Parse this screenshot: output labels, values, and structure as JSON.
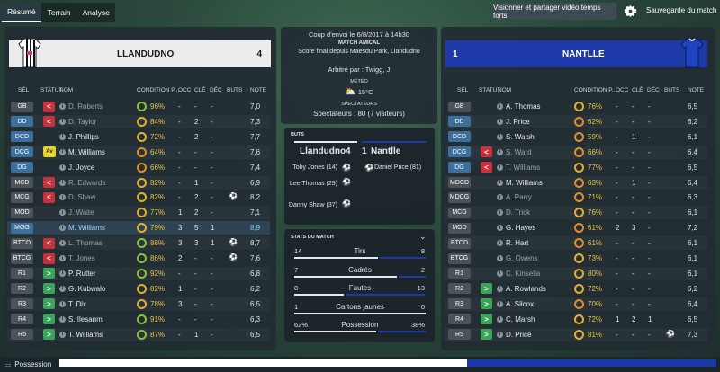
{
  "nav": {
    "tabs": [
      "Résumé",
      "Terrain",
      "Analyse"
    ],
    "active": 0
  },
  "toolbar": {
    "video_label": "Visionner et partager vidéo temps forts",
    "save_label": "Sauvegarde du match"
  },
  "info": {
    "kickoff": "Coup d'envoi le 6/8/2017 à 14h30",
    "competition": "MATCH AMICAL",
    "venue": "Score final depuis Maesdu Park, Llandudno",
    "referee": "Arbitré par : Twigg, J",
    "weather_label": "MÉTÉO",
    "weather_value": "15°C",
    "spectators_label": "SPECTATEURS",
    "spectators_value": "Spectateurs : 80 (7 visiteurs)"
  },
  "home": {
    "name": "LLANDUDNO",
    "score": "4",
    "color": "#eeeeee",
    "text_color": "#1a1a1a"
  },
  "away": {
    "name": "NANTLLE",
    "score": "1",
    "color": "#1e3aa8",
    "text_color": "#ffffff"
  },
  "headers": {
    "sel": "SÉL",
    "statut": "STATUT",
    "nom": "NOM",
    "cond": "CONDITION P...",
    "occ": "OCC",
    "cle": "CLÉ",
    "dec": "DÉC",
    "buts": "BUTS",
    "note": "NOTE"
  },
  "home_players": [
    {
      "pos": "GB",
      "posc": "#4a5358",
      "stat": "sub",
      "name": "D. Roberts",
      "cond": "96%",
      "ring": "g",
      "occ": "-",
      "cle": "-",
      "dec": "-",
      "goal": "",
      "note": "7,0",
      "dim": true
    },
    {
      "pos": "DD",
      "posc": "#3b6f9c",
      "stat": "sub",
      "name": "D. Taylor",
      "cond": "84%",
      "ring": "y",
      "occ": "-",
      "cle": "2",
      "dec": "-",
      "goal": "",
      "note": "7,3",
      "dim": true
    },
    {
      "pos": "DCD",
      "posc": "#3b6f9c",
      "stat": "",
      "name": "J. Phillips",
      "cond": "72%",
      "ring": "y",
      "occ": "-",
      "cle": "2",
      "dec": "-",
      "goal": "",
      "note": "7,7",
      "dim": false
    },
    {
      "pos": "DCG",
      "posc": "#3b6f9c",
      "stat": "Av",
      "name": "M. Williams",
      "cond": "64%",
      "ring": "o",
      "occ": "-",
      "cle": "-",
      "dec": "-",
      "goal": "",
      "note": "7,6",
      "dim": false
    },
    {
      "pos": "DG",
      "posc": "#3b6f9c",
      "stat": "",
      "name": "J. Joyce",
      "cond": "66%",
      "ring": "o",
      "occ": "-",
      "cle": "-",
      "dec": "-",
      "goal": "",
      "note": "7,4",
      "dim": false
    },
    {
      "pos": "MCD",
      "posc": "#4a5358",
      "stat": "sub",
      "name": "R. Edwards",
      "cond": "82%",
      "ring": "y",
      "occ": "-",
      "cle": "1",
      "dec": "-",
      "goal": "",
      "note": "6,9",
      "dim": true
    },
    {
      "pos": "MCG",
      "posc": "#4a5358",
      "stat": "sub",
      "name": "D. Shaw",
      "cond": "82%",
      "ring": "y",
      "occ": "-",
      "cle": "2",
      "dec": "-",
      "goal": "⚽",
      "note": "8,2",
      "dim": true
    },
    {
      "pos": "MOD",
      "posc": "#4a5358",
      "stat": "",
      "name": "J. Waite",
      "cond": "77%",
      "ring": "y",
      "occ": "1",
      "cle": "2",
      "dec": "-",
      "goal": "",
      "note": "7,1",
      "dim": true
    },
    {
      "pos": "MOG",
      "posc": "#3b6f9c",
      "stat": "",
      "name": "M. Williams",
      "cond": "79%",
      "ring": "y",
      "occ": "3",
      "cle": "5",
      "dec": "1",
      "goal": "",
      "note": "8,9",
      "dim": false,
      "hl": true
    },
    {
      "pos": "BTCD",
      "posc": "#4a5358",
      "stat": "sub",
      "name": "L. Thomas",
      "cond": "88%",
      "ring": "g",
      "occ": "3",
      "cle": "3",
      "dec": "1",
      "goal": "⚽",
      "note": "8,7",
      "dim": true
    },
    {
      "pos": "BTCG",
      "posc": "#4a5358",
      "stat": "sub",
      "name": "T. Jones",
      "cond": "86%",
      "ring": "g",
      "occ": "2",
      "cle": "-",
      "dec": "-",
      "goal": "⚽",
      "note": "7,6",
      "dim": true
    },
    {
      "pos": "R1",
      "posc": "#4a5358",
      "stat": "in",
      "name": "P. Rutter",
      "cond": "92%",
      "ring": "g",
      "occ": "-",
      "cle": "-",
      "dec": "-",
      "goal": "",
      "note": "6,8",
      "dim": false
    },
    {
      "pos": "R2",
      "posc": "#4a5358",
      "stat": "in",
      "name": "G. Kubwalo",
      "cond": "82%",
      "ring": "y",
      "occ": "1",
      "cle": "-",
      "dec": "-",
      "goal": "",
      "note": "6,2",
      "dim": false
    },
    {
      "pos": "R3",
      "posc": "#4a5358",
      "stat": "in",
      "name": "T. Dix",
      "cond": "78%",
      "ring": "y",
      "occ": "3",
      "cle": "-",
      "dec": "-",
      "goal": "",
      "note": "6,5",
      "dim": false
    },
    {
      "pos": "R4",
      "posc": "#4a5358",
      "stat": "in",
      "name": "S. Ilesanmi",
      "cond": "91%",
      "ring": "g",
      "occ": "-",
      "cle": "-",
      "dec": "-",
      "goal": "",
      "note": "6,3",
      "dim": false
    },
    {
      "pos": "R5",
      "posc": "#4a5358",
      "stat": "in",
      "name": "T. Williams",
      "cond": "87%",
      "ring": "g",
      "occ": "-",
      "cle": "1",
      "dec": "-",
      "goal": "",
      "note": "6,5",
      "dim": false
    }
  ],
  "away_players": [
    {
      "pos": "GB",
      "posc": "#4a5358",
      "stat": "",
      "name": "A. Thomas",
      "cond": "76%",
      "ring": "y",
      "occ": "-",
      "cle": "-",
      "dec": "-",
      "goal": "",
      "note": "6,5",
      "dim": false
    },
    {
      "pos": "DD",
      "posc": "#3b6f9c",
      "stat": "",
      "name": "J. Price",
      "cond": "62%",
      "ring": "o",
      "occ": "-",
      "cle": "-",
      "dec": "-",
      "goal": "",
      "note": "6,2",
      "dim": false
    },
    {
      "pos": "DCD",
      "posc": "#3b6f9c",
      "stat": "",
      "name": "S. Walsh",
      "cond": "59%",
      "ring": "o",
      "occ": "-",
      "cle": "1",
      "dec": "-",
      "goal": "",
      "note": "6,1",
      "dim": false
    },
    {
      "pos": "DCG",
      "posc": "#3b6f9c",
      "stat": "sub",
      "name": "S. Ward",
      "cond": "66%",
      "ring": "o",
      "occ": "-",
      "cle": "-",
      "dec": "-",
      "goal": "",
      "note": "6,4",
      "dim": true
    },
    {
      "pos": "DG",
      "posc": "#3b6f9c",
      "stat": "sub",
      "name": "T. Williams",
      "cond": "77%",
      "ring": "y",
      "occ": "-",
      "cle": "-",
      "dec": "-",
      "goal": "",
      "note": "6,5",
      "dim": true
    },
    {
      "pos": "MDCD",
      "posc": "#4a5358",
      "stat": "",
      "name": "M. Williams",
      "cond": "63%",
      "ring": "o",
      "occ": "-",
      "cle": "1",
      "dec": "-",
      "goal": "",
      "note": "6,4",
      "dim": false
    },
    {
      "pos": "MDCG",
      "posc": "#4a5358",
      "stat": "",
      "name": "A. Parry",
      "cond": "71%",
      "ring": "o",
      "occ": "-",
      "cle": "-",
      "dec": "-",
      "goal": "",
      "note": "6,3",
      "dim": true
    },
    {
      "pos": "MCG",
      "posc": "#4a5358",
      "stat": "",
      "name": "D. Trick",
      "cond": "76%",
      "ring": "y",
      "occ": "-",
      "cle": "-",
      "dec": "-",
      "goal": "",
      "note": "6,1",
      "dim": true
    },
    {
      "pos": "MOD",
      "posc": "#4a5358",
      "stat": "",
      "name": "G. Hayes",
      "cond": "61%",
      "ring": "o",
      "occ": "2",
      "cle": "3",
      "dec": "-",
      "goal": "",
      "note": "7,2",
      "dim": false
    },
    {
      "pos": "BTCD",
      "posc": "#4a5358",
      "stat": "",
      "name": "R. Hart",
      "cond": "61%",
      "ring": "o",
      "occ": "-",
      "cle": "-",
      "dec": "-",
      "goal": "",
      "note": "6,1",
      "dim": false
    },
    {
      "pos": "BTCG",
      "posc": "#4a5358",
      "stat": "",
      "name": "G. Owens",
      "cond": "73%",
      "ring": "y",
      "occ": "-",
      "cle": "-",
      "dec": "-",
      "goal": "",
      "note": "6,1",
      "dim": true
    },
    {
      "pos": "R1",
      "posc": "#4a5358",
      "stat": "",
      "name": "C. Kinsella",
      "cond": "80%",
      "ring": "y",
      "occ": "-",
      "cle": "-",
      "dec": "-",
      "goal": "",
      "note": "6,1",
      "dim": true
    },
    {
      "pos": "R2",
      "posc": "#4a5358",
      "stat": "in",
      "name": "A. Rowlands",
      "cond": "72%",
      "ring": "y",
      "occ": "-",
      "cle": "-",
      "dec": "-",
      "goal": "",
      "note": "6,2",
      "dim": false
    },
    {
      "pos": "R3",
      "posc": "#4a5358",
      "stat": "in",
      "name": "A. Silcox",
      "cond": "70%",
      "ring": "o",
      "occ": "-",
      "cle": "-",
      "dec": "-",
      "goal": "",
      "note": "6,4",
      "dim": false
    },
    {
      "pos": "R4",
      "posc": "#4a5358",
      "stat": "in",
      "name": "C. Marsh",
      "cond": "72%",
      "ring": "y",
      "occ": "1",
      "cle": "2",
      "dec": "1",
      "goal": "",
      "note": "6,5",
      "dim": false
    },
    {
      "pos": "R5",
      "posc": "#4a5358",
      "stat": "in",
      "name": "D. Price",
      "cond": "81%",
      "ring": "y",
      "occ": "-",
      "cle": "-",
      "dec": "-",
      "goal": "⚽",
      "note": "7,3",
      "dim": false
    }
  ],
  "goals": {
    "title": "BUTS",
    "home_team": "Llandudno",
    "home_score": "4",
    "away_score": "1",
    "away_team": "Nantlle",
    "home_scorers": [
      "Toby Jones (14)",
      "Lee Thomas (29)",
      "Danny Shaw (37)"
    ],
    "away_scorers": [
      "Daniel Price (81)"
    ]
  },
  "match_stats": {
    "title": "STATS DU MATCH",
    "rows": [
      {
        "label": "Tirs",
        "home": "14",
        "away": "8",
        "hfrac": 0.64
      },
      {
        "label": "Cadrés",
        "home": "7",
        "away": "2",
        "hfrac": 0.78
      },
      {
        "label": "Fautes",
        "home": "8",
        "away": "13",
        "hfrac": 0.38
      },
      {
        "label": "Cartons jaunes",
        "home": "1",
        "away": "0",
        "hfrac": 1.0
      },
      {
        "label": "Possession",
        "home": "62%",
        "away": "38%",
        "hfrac": 0.62
      }
    ]
  },
  "possession": {
    "label": "Possession",
    "home_frac": 0.62
  }
}
